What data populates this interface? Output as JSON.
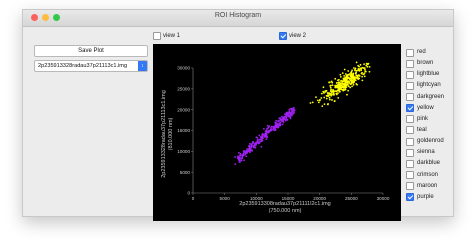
{
  "window": {
    "title": "ROI Histogram"
  },
  "views": [
    {
      "label": "view 1",
      "checked": false
    },
    {
      "label": "view 2",
      "checked": true
    }
  ],
  "controls": {
    "save_label": "Save Plot",
    "image_select": "2p235913328radau37p21113c1.img"
  },
  "colors": [
    {
      "label": "red",
      "checked": false
    },
    {
      "label": "brown",
      "checked": false
    },
    {
      "label": "lightblue",
      "checked": false
    },
    {
      "label": "lightcyan",
      "checked": false
    },
    {
      "label": "darkgreen",
      "checked": false
    },
    {
      "label": "yellow",
      "checked": true
    },
    {
      "label": "pink",
      "checked": false
    },
    {
      "label": "teal",
      "checked": false
    },
    {
      "label": "goldenrod",
      "checked": false
    },
    {
      "label": "sienna",
      "checked": false
    },
    {
      "label": "darkblue",
      "checked": false
    },
    {
      "label": "crimson",
      "checked": false
    },
    {
      "label": "maroon",
      "checked": false
    },
    {
      "label": "purple",
      "checked": true
    }
  ],
  "chart_data": {
    "type": "scatter",
    "xlabel": "2p235913308radau37p21111l2c1.img",
    "xlabel_sub": "(750.000 nm)",
    "ylabel": "2p235913328radau37p21113c1.img",
    "ylabel_sub": "(810.000 nm)",
    "xlim": [
      0,
      30000
    ],
    "ylim": [
      0,
      30000
    ],
    "xticks": [
      0,
      5000,
      10000,
      15000,
      20000,
      25000,
      30000
    ],
    "yticks": [
      0,
      5000,
      10000,
      15000,
      20000,
      25000,
      30000
    ],
    "background": "#000000",
    "series": [
      {
        "color": "#a020f0",
        "x_range": [
          7000,
          16000
        ],
        "y_range": [
          8000,
          20000
        ],
        "count": 320,
        "spread": 450
      },
      {
        "color": "#ffff00",
        "x_range": [
          19500,
          27500
        ],
        "y_range": [
          22000,
          30000
        ],
        "count": 340,
        "spread": 900
      }
    ]
  }
}
